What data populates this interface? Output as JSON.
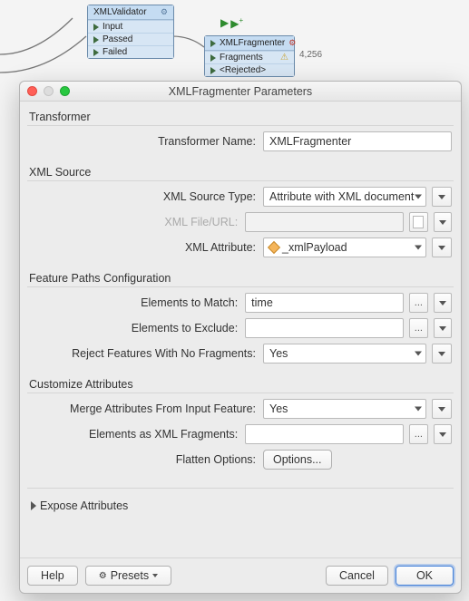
{
  "canvas": {
    "node1": {
      "title": "XMLValidator",
      "ports": [
        "Input",
        "Passed",
        "Failed"
      ]
    },
    "node2": {
      "title": "XMLFragmenter",
      "ports": [
        "Fragments",
        "<Rejected>"
      ],
      "count": "4,256"
    }
  },
  "dialog": {
    "title": "XMLFragmenter Parameters",
    "sections": {
      "transformer": {
        "heading": "Transformer",
        "name_label": "Transformer Name:",
        "name_value": "XMLFragmenter"
      },
      "xmlsource": {
        "heading": "XML Source",
        "sourcetype_label": "XML Source Type:",
        "sourcetype_value": "Attribute with XML document",
        "fileurl_label": "XML File/URL:",
        "fileurl_value": "",
        "attr_label": "XML Attribute:",
        "attr_value": "_xmlPayload"
      },
      "paths": {
        "heading": "Feature Paths Configuration",
        "match_label": "Elements to Match:",
        "match_value": "time",
        "exclude_label": "Elements to Exclude:",
        "exclude_value": "",
        "reject_label": "Reject Features With No Fragments:",
        "reject_value": "Yes"
      },
      "customize": {
        "heading": "Customize Attributes",
        "merge_label": "Merge Attributes From Input Feature:",
        "merge_value": "Yes",
        "asxml_label": "Elements as XML Fragments:",
        "asxml_value": "",
        "flatten_label": "Flatten Options:",
        "flatten_btn": "Options..."
      },
      "expose": "Expose Attributes"
    },
    "footer": {
      "help": "Help",
      "presets": "Presets",
      "cancel": "Cancel",
      "ok": "OK"
    }
  }
}
